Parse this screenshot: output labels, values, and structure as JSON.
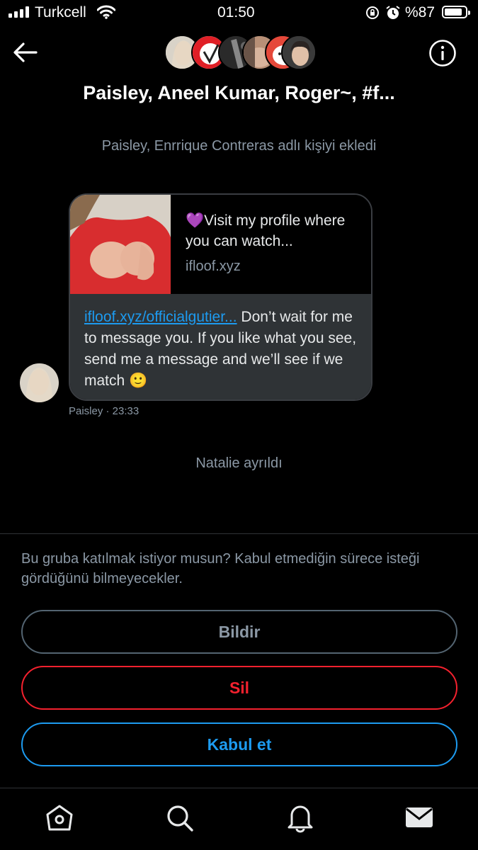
{
  "status_bar": {
    "carrier": "Turkcell",
    "time": "01:50",
    "battery_percent": "%87",
    "battery_level": 0.87
  },
  "header": {
    "title": "Paisley, Aneel Kumar, Roger~, #f..."
  },
  "conversation": {
    "system_added": "Paisley, Enrrique Contreras adlı kişiyi ekledi",
    "card": {
      "title": "💜Visit my profile where you can watch...",
      "domain": "ifloof.xyz"
    },
    "message": {
      "link_text": "ifloof.xyz/officialgutier...",
      "body": " Don’t wait for me to message you. If you like what you see, send me a message and we’ll see if we match 🙂"
    },
    "meta": "Paisley · 23:33",
    "system_left": "Natalie ayrıldı"
  },
  "request": {
    "prompt": "Bu gruba katılmak istiyor musun? Kabul etmediğin sürece isteği gördüğünü bilmeyecekler.",
    "report_label": "Bildir",
    "delete_label": "Sil",
    "accept_label": "Kabul et"
  },
  "colors": {
    "accent": "#1d9bf0",
    "danger": "#f4212e",
    "background": "#000000"
  },
  "icons": [
    "back-arrow-icon",
    "info-icon",
    "home-icon",
    "search-icon",
    "notifications-icon",
    "messages-icon"
  ]
}
